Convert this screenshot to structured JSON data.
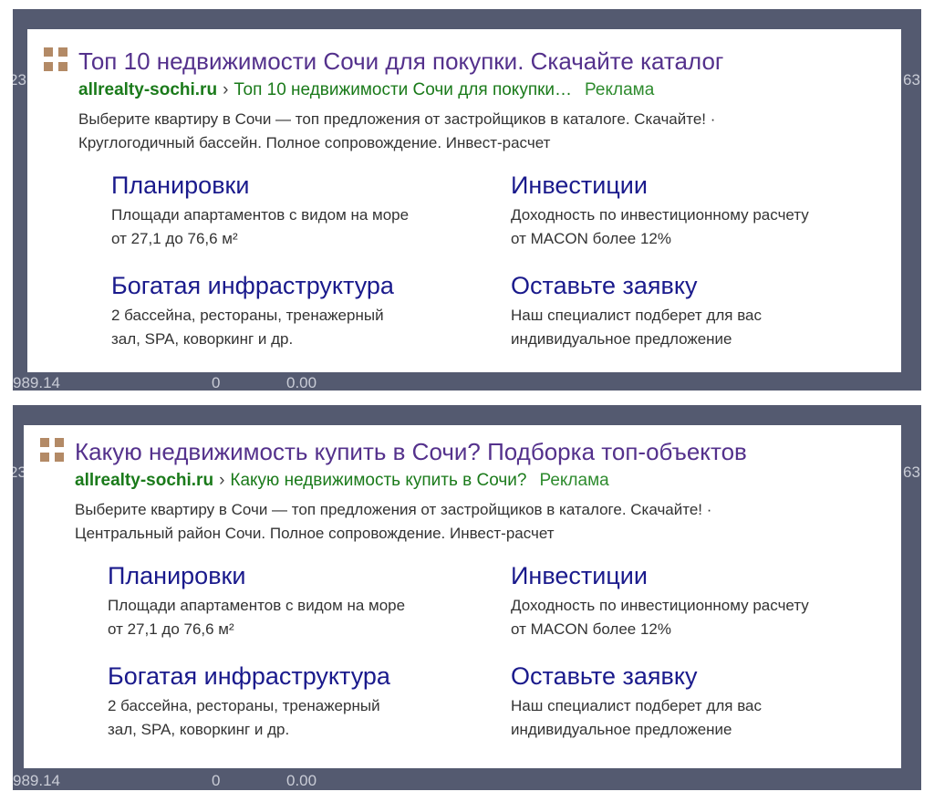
{
  "background_table": {
    "cells": [
      "989.14",
      "0",
      "0.00",
      "23",
      "63"
    ]
  },
  "ads": [
    {
      "title": "Топ 10 недвижимости Сочи для покупки. Скачайте каталог",
      "domain": "allrealty-sochi.ru",
      "separator": "›",
      "path": "Топ 10 недвижимости Сочи для покупки…",
      "ad_label": "Реклама",
      "desc_line1": "Выберите квартиру в Сочи — топ предложения от застройщиков в каталоге. Скачайте! ·",
      "desc_line2": "Круглогодичный бассейн. Полное сопровождение. Инвест-расчет",
      "sitelinks": [
        {
          "title": "Планировки",
          "line1": "Площади апартаментов с видом на море",
          "line2": "от 27,1 до 76,6 м²"
        },
        {
          "title": "Инвестиции",
          "line1": "Доходность по инвестиционному расчету",
          "line2": "от MACON более 12%"
        },
        {
          "title": "Богатая инфраструктура",
          "line1": "2 бассейна, рестораны, тренажерный",
          "line2": "зал, SPA, коворкинг и др."
        },
        {
          "title": "Оставьте заявку",
          "line1": "Наш специалист подберет для вас",
          "line2": "индивидуальное предложение"
        }
      ]
    },
    {
      "title": "Какую недвижимость купить в Сочи? Подборка топ-объектов",
      "domain": "allrealty-sochi.ru",
      "separator": "›",
      "path": "Какую недвижимость купить в Сочи?",
      "ad_label": "Реклама",
      "desc_line1": "Выберите квартиру в Сочи — топ предложения от застройщиков в каталоге. Скачайте! ·",
      "desc_line2": "Центральный район Сочи. Полное сопровождение. Инвест-расчет",
      "sitelinks": [
        {
          "title": "Планировки",
          "line1": "Площади апартаментов с видом на море",
          "line2": "от 27,1 до 76,6 м²"
        },
        {
          "title": "Инвестиции",
          "line1": "Доходность по инвестиционному расчету",
          "line2": "от MACON более 12%"
        },
        {
          "title": "Богатая инфраструктура",
          "line1": "2 бассейна, рестораны, тренажерный",
          "line2": "зал, SPA, коворкинг и др."
        },
        {
          "title": "Оставьте заявку",
          "line1": "Наш специалист подберет для вас",
          "line2": "индивидуальное предложение"
        }
      ]
    }
  ],
  "colors": {
    "frame": "#545a70",
    "title": "#54318c",
    "url": "#1a7a1a",
    "sitelink": "#1a1a8c",
    "logo": "#b38a66"
  },
  "icons": {
    "logo": "four-squares-logo-icon"
  }
}
